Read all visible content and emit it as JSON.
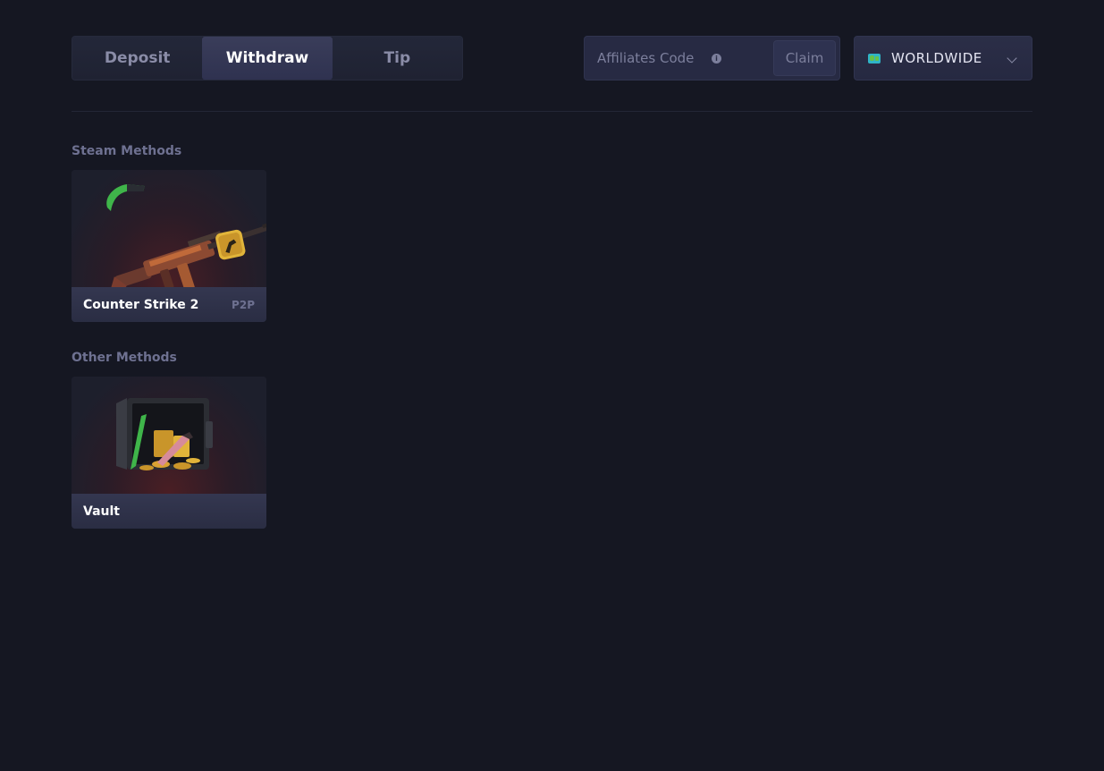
{
  "tabs": [
    {
      "label": "Deposit",
      "active": false
    },
    {
      "label": "Withdraw",
      "active": true
    },
    {
      "label": "Tip",
      "active": false
    }
  ],
  "affiliate": {
    "placeholder": "Affiliates Code",
    "value": "",
    "claim_label": "Claim",
    "info_icon": "info-icon"
  },
  "region": {
    "label": "WORLDWIDE",
    "icon": "globe-flag-icon"
  },
  "sections": [
    {
      "title": "Steam Methods",
      "cards": [
        {
          "name": "Counter Strike 2",
          "tag": "P2P",
          "image": "cs2-weapons-image"
        }
      ]
    },
    {
      "title": "Other Methods",
      "cards": [
        {
          "name": "Vault",
          "tag": "",
          "image": "vault-safe-image"
        }
      ]
    }
  ],
  "colors": {
    "background": "#151722",
    "active_tab": "#3a3d5a",
    "card_footer": "#343750",
    "muted_text": "#6e7191"
  }
}
